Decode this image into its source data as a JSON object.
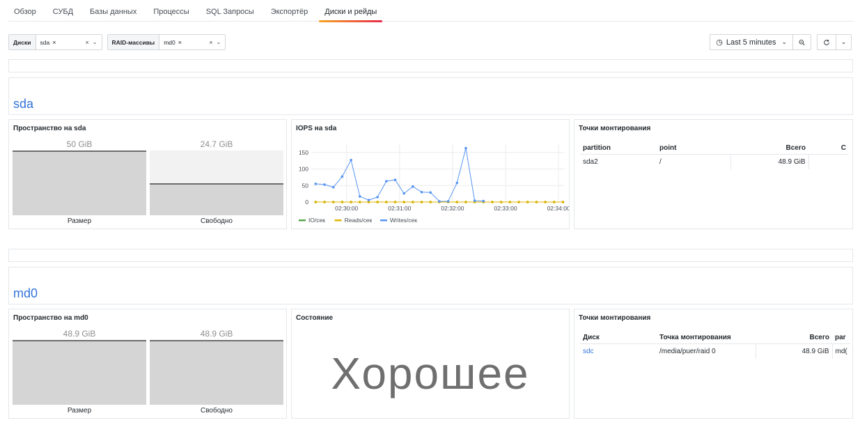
{
  "tabs": [
    {
      "label": "Обзор"
    },
    {
      "label": "СУБД"
    },
    {
      "label": "Базы данных"
    },
    {
      "label": "Процессы"
    },
    {
      "label": "SQL Запросы"
    },
    {
      "label": "Экспортёр"
    },
    {
      "label": "Диски и рейды",
      "active": true
    }
  ],
  "filters": {
    "disks": {
      "label": "Диски",
      "value": "sda"
    },
    "raid": {
      "label": "RAID-массивы",
      "value": "md0"
    },
    "clear_icon": "x-icon",
    "caret_icon": "chevron-down-icon"
  },
  "time": {
    "range": "Last 5 minutes",
    "clock_icon": "clock-icon",
    "zoom_icon": "zoom-out-icon",
    "refresh_icon": "refresh-icon"
  },
  "sda": {
    "title": "sda",
    "space": {
      "title": "Пространство на sda",
      "size": {
        "value": "50 GiB",
        "label": "Размер",
        "fraction": 1.0
      },
      "free": {
        "value": "24.7 GiB",
        "label": "Свободно",
        "fraction": 0.494
      }
    },
    "iops": {
      "title": "IOPS на sda"
    },
    "mounts": {
      "title": "Точки монтирования",
      "headers": [
        "partition",
        "point",
        "Всего",
        "С"
      ],
      "rows": [
        [
          "sda2",
          "/",
          "48.9 GiB",
          ""
        ]
      ]
    }
  },
  "md0": {
    "title": "md0",
    "space": {
      "title": "Пространство на md0",
      "size": {
        "value": "48.9 GiB",
        "label": "Размер",
        "fraction": 1.0
      },
      "free": {
        "value": "48.9 GiB",
        "label": "Свободно",
        "fraction": 1.0
      }
    },
    "state": {
      "title": "Состояние",
      "value": "Хорошее"
    },
    "mounts": {
      "title": "Точки монтирования",
      "headers": [
        "Диск",
        "Точка монтирования",
        "Всего",
        "par"
      ],
      "rows": [
        [
          "sdc",
          "/media/puer/raid 0",
          "48.9 GiB",
          "md("
        ]
      ]
    }
  },
  "chart_data": {
    "type": "line",
    "title": "IOPS на sda",
    "x_tick_labels": [
      "02:30:00",
      "02:31:00",
      "02:32:00",
      "02:33:00",
      "02:34:00"
    ],
    "y_tick_labels": [
      "0",
      "50",
      "100",
      "150"
    ],
    "ylim": [
      0,
      175
    ],
    "x": [
      "02:29:25",
      "02:29:35",
      "02:29:45",
      "02:29:55",
      "02:30:05",
      "02:30:15",
      "02:30:25",
      "02:30:35",
      "02:30:45",
      "02:30:55",
      "02:31:05",
      "02:31:15",
      "02:31:25",
      "02:31:35",
      "02:31:45",
      "02:31:55",
      "02:32:05",
      "02:32:15",
      "02:32:25",
      "02:32:35",
      "02:32:45",
      "02:32:55",
      "02:33:05",
      "02:33:15",
      "02:33:25",
      "02:33:35",
      "02:33:45",
      "02:33:55",
      "02:34:05"
    ],
    "series": [
      {
        "name": "IO/сек",
        "color": "#56a64b",
        "values": [
          0,
          0,
          0,
          0,
          0,
          0,
          0,
          0,
          0,
          0,
          0,
          0,
          0,
          0,
          0,
          0,
          0,
          0,
          0,
          0,
          0,
          0,
          0,
          0,
          0,
          0,
          0,
          0,
          0
        ]
      },
      {
        "name": "Reads/сек",
        "color": "#e0b400",
        "values": [
          0,
          0,
          0,
          0,
          0,
          0,
          0,
          0,
          0,
          0,
          0,
          0,
          0,
          0,
          0,
          0,
          0,
          0,
          0,
          0,
          0,
          0,
          0,
          0,
          0,
          0,
          0,
          0,
          0
        ]
      },
      {
        "name": "Writes/сек",
        "color": "#5794f2",
        "values": [
          55,
          53,
          45,
          77,
          127,
          17,
          6,
          15,
          63,
          67,
          26,
          47,
          30,
          29,
          2,
          2,
          58,
          163,
          4,
          3
        ]
      }
    ],
    "legend_position": "bottom-left",
    "grid": true
  }
}
